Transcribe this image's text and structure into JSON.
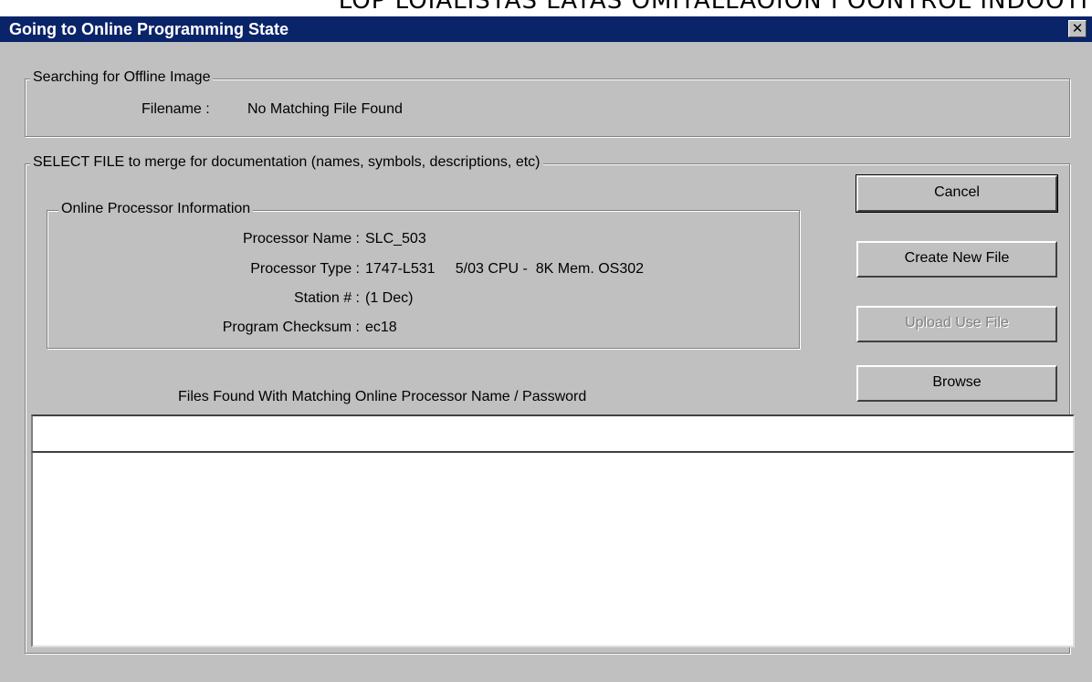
{
  "background_header_text": "LOP LOIALISTAS LATAS OMITALLAOION I OONTROL INDOOTI",
  "window": {
    "title": "Going to Online Programming State",
    "close_symbol": "✕"
  },
  "offline_image": {
    "legend": "Searching for Offline Image",
    "filename_label": "Filename :",
    "filename_value": "No Matching File Found"
  },
  "select_file": {
    "legend": "SELECT FILE to merge for documentation (names, symbols, descriptions, etc)",
    "processor_info": {
      "legend": "Online Processor Information",
      "rows": [
        {
          "label": "Processor Name :",
          "value": "SLC_503"
        },
        {
          "label": "Processor Type :",
          "value": "1747-L531     5/03 CPU -  8K Mem. OS302"
        },
        {
          "label": "Station # :",
          "value": "(1 Dec)"
        },
        {
          "label": "Program Checksum :",
          "value": "ec18"
        }
      ]
    },
    "files_found_label": "Files Found With Matching Online Processor Name / Password"
  },
  "buttons": {
    "cancel": "Cancel",
    "create_new_file": "Create New File",
    "upload_use_file": "Upload Use File",
    "browse": "Browse"
  }
}
